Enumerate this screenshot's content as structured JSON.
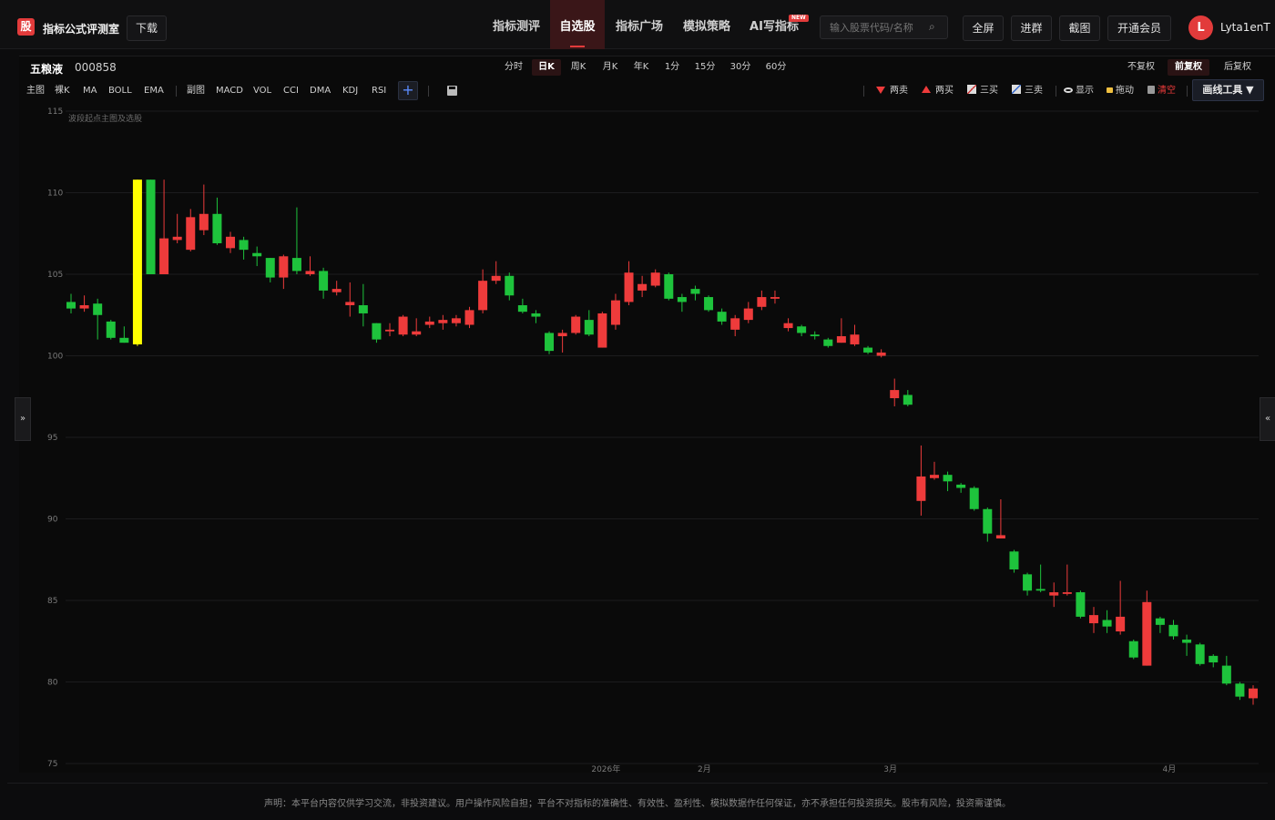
{
  "header": {
    "logo_glyph": "股",
    "brand": "指标公式评测室",
    "download_label": "下载",
    "nav": [
      {
        "label": "指标测评",
        "active": false
      },
      {
        "label": "自选股",
        "active": true
      },
      {
        "label": "指标广场",
        "active": false
      },
      {
        "label": "模拟策略",
        "active": false
      },
      {
        "label": "AI写指标",
        "active": false
      }
    ],
    "new_badge": "NEW",
    "search_placeholder": "输入股票代码/名称",
    "actions": [
      "全屏",
      "进群",
      "截图",
      "开通会员"
    ],
    "avatar_letter": "L",
    "username": "Lyta1enT"
  },
  "stock": {
    "name": "五粮液",
    "code": "000858"
  },
  "periods": [
    {
      "label": "分时",
      "active": false
    },
    {
      "label": "日K",
      "active": true
    },
    {
      "label": "周K",
      "active": false
    },
    {
      "label": "月K",
      "active": false
    },
    {
      "label": "年K",
      "active": false
    },
    {
      "label": "1分",
      "active": false
    },
    {
      "label": "15分",
      "active": false
    },
    {
      "label": "30分",
      "active": false
    },
    {
      "label": "60分",
      "active": false
    }
  ],
  "adjust": [
    {
      "label": "不复权",
      "active": false
    },
    {
      "label": "前复权",
      "active": true
    },
    {
      "label": "后复权",
      "active": false
    }
  ],
  "indicators": {
    "main_group": [
      "主图",
      "裸K",
      "MA",
      "BOLL",
      "EMA"
    ],
    "sub_group": [
      "副图",
      "MACD",
      "VOL",
      "CCI",
      "DMA",
      "KDJ",
      "RSI"
    ]
  },
  "tools": {
    "two_sell": "两卖",
    "two_buy": "两买",
    "three_buy": "三买",
    "three_sell": "三卖",
    "show": "显示",
    "drag": "拖动",
    "clear": "清空",
    "drawing_tools": "画线工具 ▼"
  },
  "colors": {
    "up": "#ee3b3b",
    "down": "#1ec33c",
    "highlight": "#ffff00",
    "accent": "#e23b3b"
  },
  "chart_data": {
    "type": "candlestick",
    "title": "波段起点主图及选股",
    "ylim": [
      75,
      115
    ],
    "yticks": [
      75,
      80,
      85,
      90,
      95,
      100,
      105,
      110,
      115
    ],
    "xtick_labels": [
      "2026年",
      "2月",
      "3月",
      "4月"
    ],
    "candles": [
      {
        "o": 103.3,
        "c": 102.9,
        "h": 103.8,
        "l": 102.6
      },
      {
        "o": 102.9,
        "c": 103.1,
        "h": 103.7,
        "l": 102.7
      },
      {
        "o": 103.2,
        "c": 102.5,
        "h": 103.5,
        "l": 101.0
      },
      {
        "o": 102.1,
        "c": 101.1,
        "h": 102.2,
        "l": 101.0
      },
      {
        "o": 101.1,
        "c": 100.8,
        "h": 101.8,
        "l": 100.8
      },
      {
        "o": 100.7,
        "c": 110.8,
        "h": 110.8,
        "l": 100.6,
        "hl": true
      },
      {
        "o": 110.8,
        "c": 105.0,
        "h": 110.8,
        "l": 105.0
      },
      {
        "o": 105.0,
        "c": 107.2,
        "h": 110.8,
        "l": 105.0
      },
      {
        "o": 107.1,
        "c": 107.3,
        "h": 108.7,
        "l": 106.9
      },
      {
        "o": 106.5,
        "c": 108.5,
        "h": 109.0,
        "l": 106.4
      },
      {
        "o": 107.7,
        "c": 108.7,
        "h": 110.5,
        "l": 107.4
      },
      {
        "o": 108.7,
        "c": 106.9,
        "h": 109.7,
        "l": 106.8
      },
      {
        "o": 106.6,
        "c": 107.3,
        "h": 107.6,
        "l": 106.3
      },
      {
        "o": 107.1,
        "c": 106.5,
        "h": 107.3,
        "l": 105.9
      },
      {
        "o": 106.3,
        "c": 106.1,
        "h": 106.7,
        "l": 105.5
      },
      {
        "o": 106.0,
        "c": 104.8,
        "h": 106.0,
        "l": 104.5
      },
      {
        "o": 104.8,
        "c": 106.1,
        "h": 106.2,
        "l": 104.1
      },
      {
        "o": 106.0,
        "c": 105.2,
        "h": 109.1,
        "l": 105.0
      },
      {
        "o": 105.0,
        "c": 105.2,
        "h": 106.1,
        "l": 104.9
      },
      {
        "o": 105.2,
        "c": 104.0,
        "h": 105.4,
        "l": 103.5
      },
      {
        "o": 103.9,
        "c": 104.1,
        "h": 104.6,
        "l": 103.7
      },
      {
        "o": 103.1,
        "c": 103.3,
        "h": 104.5,
        "l": 102.4
      },
      {
        "o": 103.1,
        "c": 102.6,
        "h": 104.4,
        "l": 101.8
      },
      {
        "o": 102.0,
        "c": 101.0,
        "h": 102.0,
        "l": 100.8
      },
      {
        "o": 101.5,
        "c": 101.6,
        "h": 102.0,
        "l": 101.2
      },
      {
        "o": 101.3,
        "c": 102.4,
        "h": 102.5,
        "l": 101.2
      },
      {
        "o": 101.3,
        "c": 101.5,
        "h": 102.3,
        "l": 101.2
      },
      {
        "o": 101.9,
        "c": 102.1,
        "h": 102.4,
        "l": 101.7
      },
      {
        "o": 102.0,
        "c": 102.2,
        "h": 102.5,
        "l": 101.6
      },
      {
        "o": 102.0,
        "c": 102.3,
        "h": 102.5,
        "l": 101.8
      },
      {
        "o": 101.9,
        "c": 102.8,
        "h": 103.0,
        "l": 101.7
      },
      {
        "o": 102.8,
        "c": 104.6,
        "h": 105.3,
        "l": 102.6
      },
      {
        "o": 104.6,
        "c": 104.9,
        "h": 105.8,
        "l": 104.4
      },
      {
        "o": 104.9,
        "c": 103.7,
        "h": 105.1,
        "l": 103.4
      },
      {
        "o": 103.1,
        "c": 102.7,
        "h": 103.5,
        "l": 102.6
      },
      {
        "o": 102.6,
        "c": 102.4,
        "h": 102.8,
        "l": 102.0
      },
      {
        "o": 101.4,
        "c": 100.3,
        "h": 101.5,
        "l": 100.1
      },
      {
        "o": 101.2,
        "c": 101.4,
        "h": 101.6,
        "l": 100.2
      },
      {
        "o": 101.4,
        "c": 102.4,
        "h": 102.5,
        "l": 101.3
      },
      {
        "o": 102.2,
        "c": 101.3,
        "h": 102.8,
        "l": 101.2
      },
      {
        "o": 100.5,
        "c": 102.6,
        "h": 102.7,
        "l": 100.5
      },
      {
        "o": 101.9,
        "c": 103.4,
        "h": 103.8,
        "l": 101.6
      },
      {
        "o": 103.3,
        "c": 105.1,
        "h": 105.8,
        "l": 103.1
      },
      {
        "o": 104.0,
        "c": 104.4,
        "h": 104.9,
        "l": 103.6
      },
      {
        "o": 104.3,
        "c": 105.1,
        "h": 105.3,
        "l": 104.2
      },
      {
        "o": 105.0,
        "c": 103.5,
        "h": 105.1,
        "l": 103.4
      },
      {
        "o": 103.6,
        "c": 103.3,
        "h": 103.8,
        "l": 102.7
      },
      {
        "o": 104.1,
        "c": 103.8,
        "h": 104.3,
        "l": 103.4
      },
      {
        "o": 103.6,
        "c": 102.8,
        "h": 103.7,
        "l": 102.7
      },
      {
        "o": 102.7,
        "c": 102.1,
        "h": 102.9,
        "l": 101.9
      },
      {
        "o": 101.6,
        "c": 102.3,
        "h": 102.5,
        "l": 101.2
      },
      {
        "o": 102.2,
        "c": 102.9,
        "h": 103.3,
        "l": 102.0
      },
      {
        "o": 103.0,
        "c": 103.6,
        "h": 104.0,
        "l": 102.8
      },
      {
        "o": 103.5,
        "c": 103.6,
        "h": 104.0,
        "l": 103.2
      },
      {
        "o": 101.7,
        "c": 102.0,
        "h": 102.3,
        "l": 101.5
      },
      {
        "o": 101.8,
        "c": 101.4,
        "h": 101.9,
        "l": 101.2
      },
      {
        "o": 101.3,
        "c": 101.2,
        "h": 101.5,
        "l": 101.0
      },
      {
        "o": 101.0,
        "c": 100.6,
        "h": 101.1,
        "l": 100.5
      },
      {
        "o": 100.8,
        "c": 101.2,
        "h": 102.3,
        "l": 100.8
      },
      {
        "o": 100.7,
        "c": 101.3,
        "h": 101.9,
        "l": 100.6
      },
      {
        "o": 100.5,
        "c": 100.2,
        "h": 100.6,
        "l": 100.1
      },
      {
        "o": 100.0,
        "c": 100.2,
        "h": 100.4,
        "l": 99.9
      },
      {
        "o": 97.4,
        "c": 97.9,
        "h": 98.6,
        "l": 96.9
      },
      {
        "o": 97.6,
        "c": 97.0,
        "h": 97.9,
        "l": 96.9
      },
      {
        "o": 91.1,
        "c": 92.6,
        "h": 94.5,
        "l": 90.2
      },
      {
        "o": 92.5,
        "c": 92.7,
        "h": 93.5,
        "l": 92.4
      },
      {
        "o": 92.7,
        "c": 92.3,
        "h": 92.9,
        "l": 91.7
      },
      {
        "o": 92.1,
        "c": 91.9,
        "h": 92.2,
        "l": 91.6
      },
      {
        "o": 91.9,
        "c": 90.6,
        "h": 92.0,
        "l": 90.5
      },
      {
        "o": 90.6,
        "c": 89.1,
        "h": 90.7,
        "l": 88.6
      },
      {
        "o": 88.8,
        "c": 89.0,
        "h": 91.2,
        "l": 88.8
      },
      {
        "o": 88.0,
        "c": 86.9,
        "h": 88.1,
        "l": 86.7
      },
      {
        "o": 86.6,
        "c": 85.6,
        "h": 86.7,
        "l": 85.3
      },
      {
        "o": 85.7,
        "c": 85.6,
        "h": 87.2,
        "l": 85.5
      },
      {
        "o": 85.3,
        "c": 85.5,
        "h": 86.1,
        "l": 84.6
      },
      {
        "o": 85.4,
        "c": 85.5,
        "h": 87.2,
        "l": 85.3
      },
      {
        "o": 85.5,
        "c": 84.0,
        "h": 85.6,
        "l": 83.9
      },
      {
        "o": 83.6,
        "c": 84.1,
        "h": 84.6,
        "l": 83.0
      },
      {
        "o": 83.8,
        "c": 83.4,
        "h": 84.4,
        "l": 83.0
      },
      {
        "o": 83.1,
        "c": 84.0,
        "h": 86.2,
        "l": 82.9
      },
      {
        "o": 82.5,
        "c": 81.5,
        "h": 82.6,
        "l": 81.4
      },
      {
        "o": 81.0,
        "c": 84.9,
        "h": 85.6,
        "l": 81.0
      },
      {
        "o": 83.9,
        "c": 83.5,
        "h": 84.0,
        "l": 83.0
      },
      {
        "o": 83.5,
        "c": 82.8,
        "h": 83.8,
        "l": 82.6
      },
      {
        "o": 82.6,
        "c": 82.4,
        "h": 82.9,
        "l": 81.6
      },
      {
        "o": 82.3,
        "c": 81.1,
        "h": 82.4,
        "l": 81.0
      },
      {
        "o": 81.6,
        "c": 81.2,
        "h": 81.7,
        "l": 80.9
      },
      {
        "o": 81.0,
        "c": 79.9,
        "h": 81.6,
        "l": 79.8
      },
      {
        "o": 79.9,
        "c": 79.1,
        "h": 80.0,
        "l": 78.9
      },
      {
        "o": 79.0,
        "c": 79.6,
        "h": 79.8,
        "l": 78.6
      }
    ]
  },
  "disclaimer": "声明：本平台内容仅供学习交流，非投资建议。用户操作风险自担；平台不对指标的准确性、有效性、盈利性、模拟数据作任何保证，亦不承担任何投资损失。股市有风险，投资需谨慎。"
}
